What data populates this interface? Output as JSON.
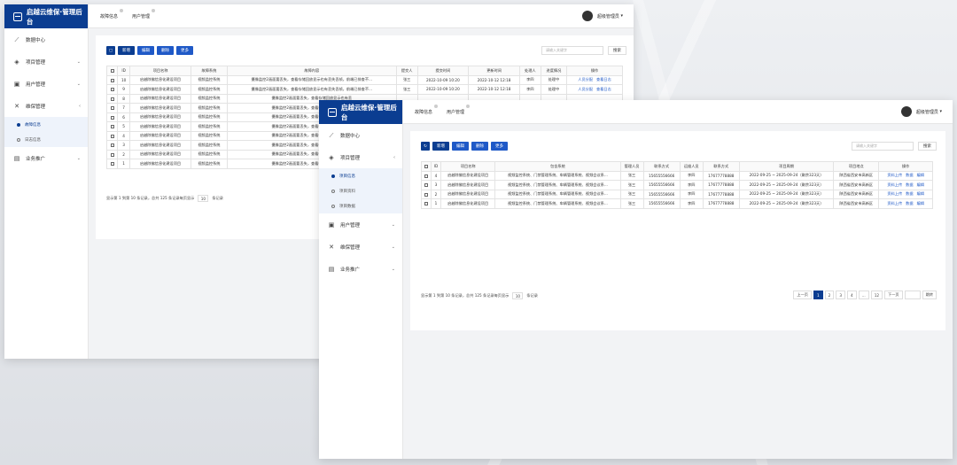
{
  "brand": "启越云维保·管理后台",
  "tabs": [
    "故障信息",
    "用户管理"
  ],
  "user": "超级管理员",
  "nav": {
    "data_center": "数据中心",
    "project_mgmt": "项目管理",
    "user_mgmt": "用户管理",
    "maint_mgmt": "维保管理",
    "business": "业务推广",
    "w1_sub": [
      "故障信息",
      "日志信息"
    ],
    "w2_sub": [
      "项目信息",
      "项目资料",
      "项目数据"
    ]
  },
  "toolbar": {
    "add": "新增",
    "edit": "编辑",
    "delete": "删除",
    "more": "更多"
  },
  "search": {
    "placeholder": "请输入关键字",
    "button": "搜索"
  },
  "faults": {
    "headers": [
      "ID",
      "项目名称",
      "故障系统",
      "故障内容",
      "提交人",
      "提交时间",
      "更新时间",
      "处理人",
      "进度情况",
      "操作"
    ],
    "rows": [
      [
        "10",
        "启越除佛信息化建设项目",
        "视频监控系统",
        "摄像监控2画面要丢失，查看存储回放显示也有丢失丢帧，前端已排查不...",
        "张三",
        "2022-10-09 10:20",
        "2022-10-12 12:18",
        "李四",
        "处理中"
      ],
      [
        "9",
        "启越除佛信息化建设项目",
        "视频监控系统",
        "摄像监控2画面要丢失，查看存储回放显示也有丢失丢帧，前端已排查不...",
        "张三",
        "2022-10-09 10:20",
        "2022-10-12 12:18",
        "李四",
        "处理中"
      ],
      [
        "8",
        "启越除佛信息化建设项目",
        "视频监控系统",
        "摄像监控2画面要丢失，查看存储回放显示也有丢",
        "",
        "",
        "",
        "",
        ""
      ],
      [
        "7",
        "启越除佛信息化建设项目",
        "视频监控系统",
        "摄像监控2画面要丢失，查看存储回放显示也有丢",
        "",
        "",
        "",
        "",
        ""
      ],
      [
        "6",
        "启越除佛信息化建设项目",
        "视频监控系统",
        "摄像监控2画面要丢失，查看存储回放显示也有丢",
        "",
        "",
        "",
        "",
        ""
      ],
      [
        "5",
        "启越除佛信息化建设项目",
        "视频监控系统",
        "摄像监控2画面要丢失，查看存储回放显示也有丢",
        "",
        "",
        "",
        "",
        ""
      ],
      [
        "4",
        "启越除佛信息化建设项目",
        "视频监控系统",
        "摄像监控2画面要丢失，查看存储回放显示也有丢",
        "",
        "",
        "",
        "",
        ""
      ],
      [
        "3",
        "启越除佛信息化建设项目",
        "视频监控系统",
        "摄像监控2画面要丢失，查看存储回放显示也有丢",
        "",
        "",
        "",
        "",
        ""
      ],
      [
        "2",
        "启越除佛信息化建设项目",
        "视频监控系统",
        "摄像监控2画面要丢失，查看存储回放显示也有丢",
        "",
        "",
        "",
        "",
        ""
      ],
      [
        "1",
        "启越除佛信息化建设项目",
        "视频监控系统",
        "摄像监控2画面要丢失，查看存储回放显示也有丢",
        "",
        "",
        "",
        "",
        ""
      ]
    ],
    "actions": [
      "人员分配",
      "查看日志"
    ]
  },
  "projects": {
    "headers": [
      "ID",
      "项目名称",
      "包含系统",
      "管理人员",
      "联系方式",
      "运维人员",
      "联系方式",
      "项目周期",
      "项目地点",
      "操作"
    ],
    "rows": [
      [
        "4",
        "启越除佛信息化建设项目",
        "视频监控系统、门禁管理系统、车辆管理系统、视频会议系...",
        "张三",
        "15655556666",
        "李四",
        "17677778888",
        "2022-09-25 ~ 2025-09-24（剩余323天）",
        "陕西省西安市高新区"
      ],
      [
        "3",
        "启越除佛信息化建设项目",
        "视频监控系统、门禁管理系统、车辆管理系统、视频会议系...",
        "张三",
        "15655556666",
        "李四",
        "17677778888",
        "2022-09-25 ~ 2025-09-24（剩余323天）",
        "陕西省西安市高新区"
      ],
      [
        "2",
        "启越除佛信息化建设项目",
        "视频监控系统、门禁管理系统、车辆管理系统、视频会议系...",
        "张三",
        "15655556666",
        "李四",
        "17677778888",
        "2022-09-25 ~ 2025-09-24（剩余323天）",
        "陕西省西安市高新区"
      ],
      [
        "1",
        "启越除佛信息化建设项目",
        "视频监控系统、门禁管理系统、车辆管理系统、视频会议系...",
        "张三",
        "15655556666",
        "李四",
        "17677778888",
        "2022-09-25 ~ 2025-09-24（剩余323天）",
        "陕西省西安市高新区"
      ]
    ],
    "actions": [
      "资料上传",
      "数据",
      "编辑"
    ]
  },
  "footer": {
    "prefix": "显示第 1 到第 10 条记录，总共 125 条记录每页显示",
    "size": "10",
    "suffix": "条记录"
  },
  "pager": [
    "上一页",
    "1",
    "2",
    "3",
    "4",
    "...",
    "12",
    "下一页",
    "",
    "跳转"
  ]
}
